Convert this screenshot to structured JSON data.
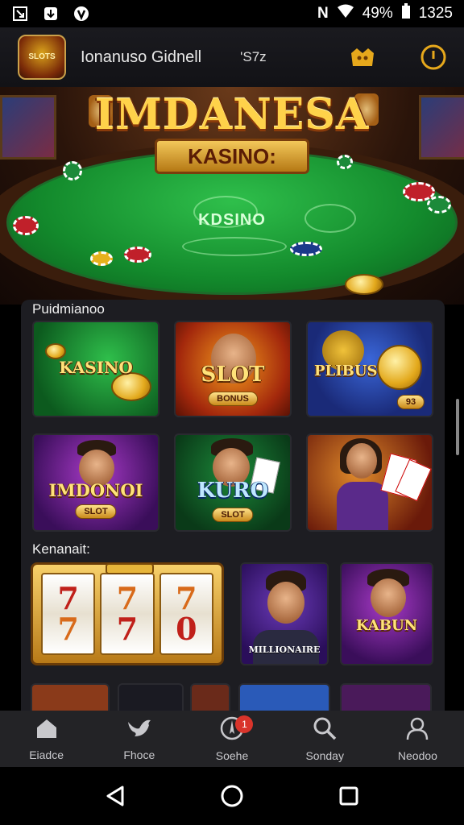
{
  "status_bar": {
    "icons_left": [
      "screenshot-icon",
      "download-icon",
      "shield-icon"
    ],
    "icons_right": [
      "nfc-icon",
      "wifi-icon",
      "battery-icon"
    ],
    "battery": "49%",
    "time": "1325"
  },
  "header": {
    "logo_text": "SLOTS",
    "title": "Ionanuso Gidnell",
    "balance": "'S7z",
    "icon_right_1": "crown-icon",
    "icon_right_2": "power-icon"
  },
  "hero": {
    "title": "IMDANESA",
    "plaque": "KASINO:",
    "felt_text": "KDSINO"
  },
  "sections": {
    "featured_title": "Puidmianoo",
    "recent_title": "Kenanait:"
  },
  "featured_tiles": [
    {
      "label": "KASINO",
      "sub": ""
    },
    {
      "label": "SLOT",
      "sub": "BONUS"
    },
    {
      "label": "PLIBUS",
      "sub": "93"
    },
    {
      "label": "IMDONOI",
      "sub": "SLOT"
    },
    {
      "label": "KURO",
      "sub": "SLOT"
    },
    {
      "label": "",
      "sub": ""
    }
  ],
  "recent_tiles": [
    {
      "label": "7 7 7",
      "sub": ""
    },
    {
      "label": "MILLIONAIRE",
      "sub": ""
    },
    {
      "label": "KABUN",
      "sub": ""
    }
  ],
  "bottom_nav": [
    {
      "label": "Eiadce",
      "icon": "home-icon"
    },
    {
      "label": "Fhoce",
      "icon": "bird-icon"
    },
    {
      "label": "Soehe",
      "icon": "compass-icon",
      "badge": "1"
    },
    {
      "label": "Sonday",
      "icon": "search-icon"
    },
    {
      "label": "Neodoo",
      "icon": "user-icon"
    }
  ],
  "colors": {
    "accent_gold": "#ffd24a",
    "felt_green": "#138a2c",
    "panel_bg": "#1d1d22",
    "nav_bg": "#232326",
    "badge_red": "#d9342b"
  }
}
